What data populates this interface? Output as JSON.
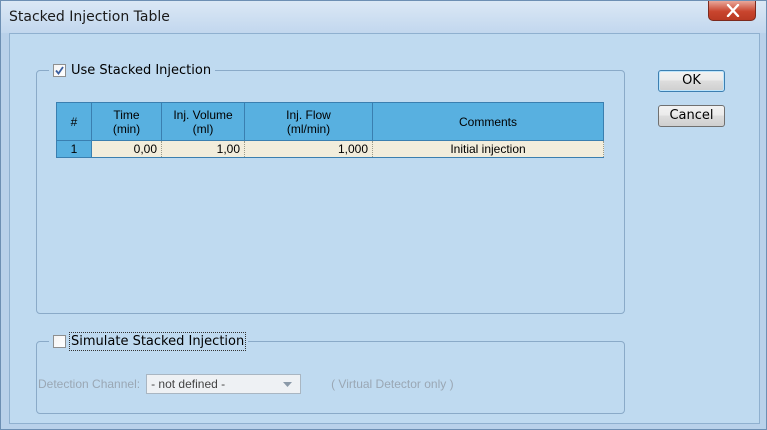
{
  "window": {
    "title": "Stacked Injection Table"
  },
  "stacked_group": {
    "checkbox_label": "Use Stacked Injection",
    "checked": true
  },
  "table": {
    "headers": {
      "index": "#",
      "time": [
        "Time",
        "(min)"
      ],
      "volume": [
        "Inj. Volume",
        "(ml)"
      ],
      "flow": [
        "Inj. Flow",
        "(ml/min)"
      ],
      "comments": "Comments"
    },
    "rows": [
      {
        "index": "1",
        "time": "0,00",
        "volume": "1,00",
        "flow": "1,000",
        "comment": "Initial injection"
      }
    ]
  },
  "buttons": {
    "ok": "OK",
    "cancel": "Cancel"
  },
  "simulate_group": {
    "checkbox_label": "Simulate Stacked Injection",
    "checked": false,
    "detection_label": "Detection Channel:",
    "detection_value": "- not defined -",
    "virtual_note": "( Virtual Detector only )"
  },
  "colors": {
    "header_bg": "#58b0e0",
    "row_bg": "#f2eddc",
    "dialog_bg": "#bfdaf0"
  },
  "icons": {
    "close": "close-x-icon",
    "checkbox": "checkmark-icon",
    "dropdown": "chevron-down-icon"
  }
}
